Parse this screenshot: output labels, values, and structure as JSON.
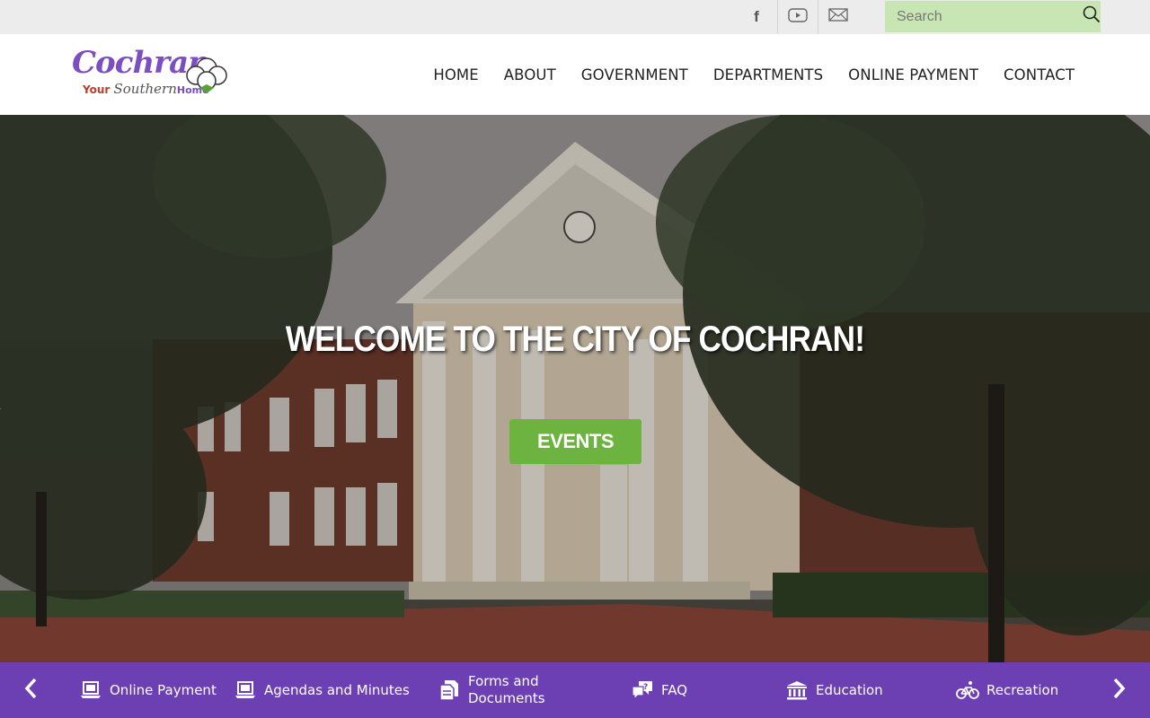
{
  "topbar": {
    "social": [
      {
        "icon": "facebook-icon",
        "label": "f"
      },
      {
        "icon": "youtube-icon"
      },
      {
        "icon": "mail-icon"
      }
    ],
    "search_placeholder": "Search"
  },
  "logo": {
    "main": "Cochran",
    "your": "Your",
    "southern": "Southern",
    "home": "Home"
  },
  "nav": {
    "items": [
      "HOME",
      "ABOUT",
      "GOVERNMENT",
      "DEPARTMENTS",
      "ONLINE PAYMENT",
      "CONTACT"
    ]
  },
  "hero": {
    "title": "WELCOME TO THE CITY OF COCHRAN!",
    "button": "EVENTS"
  },
  "quicklinks": {
    "items": [
      {
        "label": "Online Payment",
        "icon": "laptop-icon"
      },
      {
        "label": "Agendas and Minutes",
        "icon": "laptop-icon"
      },
      {
        "label": "Forms and Documents",
        "icon": "documents-icon"
      },
      {
        "label": "FAQ",
        "icon": "chat-question-icon"
      },
      {
        "label": "Education",
        "icon": "building-icon"
      },
      {
        "label": "Recreation",
        "icon": "bicycle-icon"
      }
    ]
  },
  "colors": {
    "brand_purple": "#6c3fb3",
    "accent_green": "#6db33f",
    "search_bg": "#c8e6b4"
  }
}
